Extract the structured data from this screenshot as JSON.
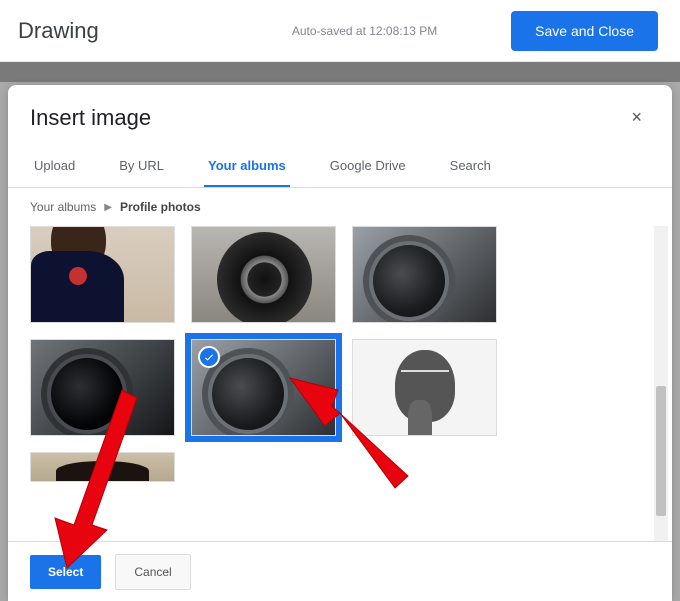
{
  "header": {
    "title": "Drawing",
    "autosave": "Auto-saved at 12:08:13 PM",
    "save_close": "Save and Close"
  },
  "modal": {
    "title": "Insert image",
    "close_glyph": "×"
  },
  "tabs": {
    "upload": "Upload",
    "by_url": "By URL",
    "your_albums": "Your albums",
    "google_drive": "Google Drive",
    "search": "Search"
  },
  "breadcrumb": {
    "root": "Your albums",
    "current": "Profile photos"
  },
  "footer": {
    "select": "Select",
    "cancel": "Cancel"
  }
}
